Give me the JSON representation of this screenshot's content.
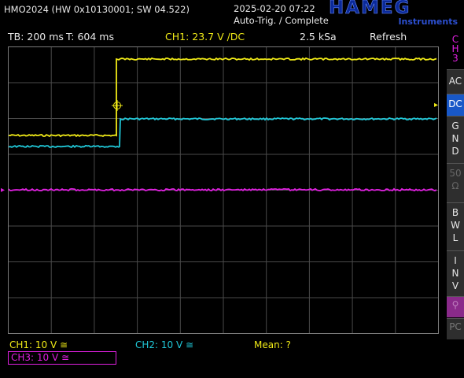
{
  "header": {
    "device": "HMO2024 (HW 0x10130001; SW 04.522)",
    "datetime": "2025-02-20 07:22",
    "trigger_state": "Auto-Trig. / Complete",
    "logo": "HAMEG",
    "logo_sub": "Instruments"
  },
  "status_bar": {
    "timebase": "TB: 200 ms",
    "trigger_time": "T: 604 ms",
    "ch1_trigger": "CH1: 23.7 V ∕DC",
    "sample_rate": "2.5 kSa",
    "refresh": "Refresh"
  },
  "side_menu": {
    "active_channel": [
      "C",
      "H",
      "3"
    ],
    "items": [
      {
        "label": "AC"
      },
      {
        "label": "DC",
        "selected": true
      },
      {
        "label": "G N D",
        "chars": [
          "G",
          "N",
          "D"
        ]
      },
      {
        "label": "50 Ω",
        "chars": [
          "50",
          "Ω"
        ],
        "disabled": true
      },
      {
        "label": "B W L",
        "chars": [
          "B",
          "W",
          "L"
        ]
      },
      {
        "label": "I N V",
        "chars": [
          "I",
          "N",
          "V"
        ]
      },
      {
        "label": "⚲",
        "chars": [
          "⚲"
        ],
        "disabled": true
      },
      {
        "label": "PC",
        "chars": [
          "PC"
        ],
        "disabled": true
      }
    ]
  },
  "channels": {
    "ch1": {
      "label": "CH1: 10 V ≅",
      "color": "#f0ea17"
    },
    "ch2": {
      "label": "CH2: 10 V ≅",
      "color": "#20c8d8"
    },
    "ch3": {
      "label": "CH3: 10 V ≅",
      "color": "#e020e0"
    },
    "mean": {
      "label": "Mean: ?",
      "color": "#f0ea17"
    }
  },
  "colors": {
    "background": "#000000",
    "grid": "#4a4a4a",
    "ch1": "#f0ea17",
    "ch2": "#20c8d8",
    "ch3": "#e020e0"
  }
}
